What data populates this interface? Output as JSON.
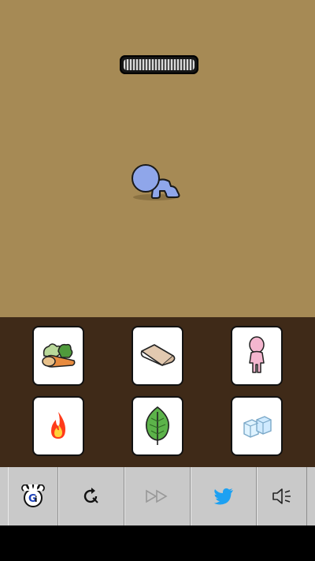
{
  "stage": {
    "energy_level": 1.0,
    "character": "crawling-baby"
  },
  "items": [
    {
      "name": "vegetables",
      "icon": "vegetables-icon"
    },
    {
      "name": "cloth",
      "icon": "cloth-icon"
    },
    {
      "name": "pink-doll",
      "icon": "doll-icon"
    },
    {
      "name": "fire",
      "icon": "fire-icon"
    },
    {
      "name": "leaf",
      "icon": "leaf-icon"
    },
    {
      "name": "ice",
      "icon": "ice-icon"
    }
  ],
  "toolbar": {
    "buttons": [
      {
        "icon": "gamer-logo-icon",
        "enabled": true
      },
      {
        "icon": "restart-icon",
        "enabled": true
      },
      {
        "icon": "fast-forward-icon",
        "enabled": false
      },
      {
        "icon": "twitter-icon",
        "enabled": true
      },
      {
        "icon": "sound-icon",
        "enabled": true
      }
    ]
  },
  "colors": {
    "stage_bg": "#a68a55",
    "tray_bg": "#3f2a18",
    "toolbar_bg": "#c9c9c9",
    "character_blue": "#8fa6ea",
    "twitter_blue": "#1da1f2"
  }
}
